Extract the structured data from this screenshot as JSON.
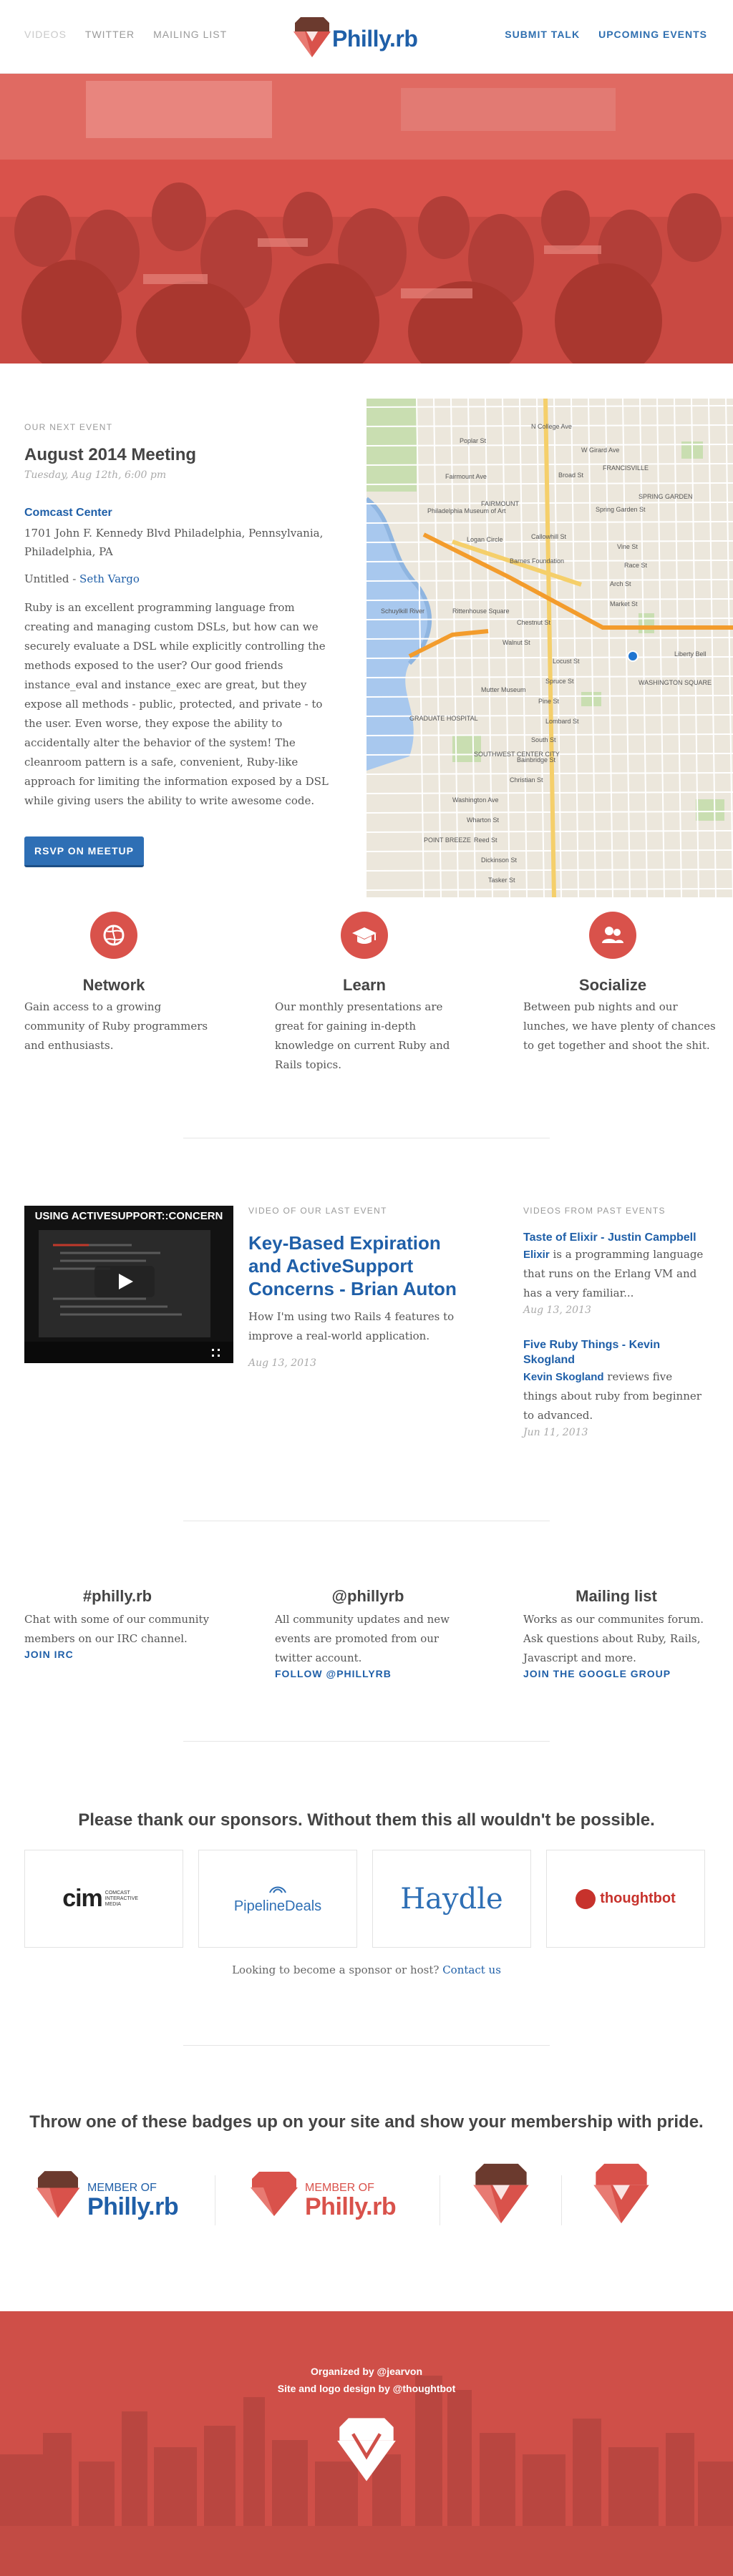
{
  "nav": {
    "left": [
      "Videos",
      "Twitter",
      "Mailing List"
    ],
    "right": [
      "Submit Talk",
      "Upcoming Events"
    ],
    "logo_text": "Philly.rb"
  },
  "event": {
    "kicker": "Our Next Event",
    "title": "August 2014 Meeting",
    "date": "Tuesday, Aug 12th, 6:00 pm",
    "venue": "Comcast Center",
    "address": "1701 John F. Kennedy Blvd Philadelphia, Pennsylvania, Philadelphia, PA",
    "talk_prefix": "Untitled - ",
    "speaker": "Seth Vargo",
    "description": "Ruby is an excellent programming language from creating and managing custom DSLs, but how can we securely evaluate a DSL while explicitly controlling the methods exposed to the user? Our good friends instance_eval and instance_exec are great, but they expose all methods - public, protected, and private - to the user. Even worse, they expose the ability to accidentally alter the behavior of the system! The cleanroom pattern is a safe, convenient, Ruby-like approach for limiting the information exposed by a DSL while giving users the ability to write awesome code.",
    "rsvp": "RSVP on Meetup"
  },
  "map": {
    "labels": [
      "N College Ave",
      "Poplar St",
      "W Girard Ave",
      "Fairmount Ave",
      "Spring Garden St",
      "Callowhill St",
      "Vine St",
      "Race St",
      "Arch St",
      "Market St",
      "Chestnut St",
      "Walnut St",
      "Locust St",
      "Spruce St",
      "Pine St",
      "Lombard St",
      "South St",
      "Bainbridge St",
      "Christian St",
      "Washington Ave",
      "Wharton St",
      "Reed St",
      "Dickinson St",
      "Tasker St",
      "Broad St",
      "Rittenhouse Square",
      "Logan Circle",
      "Philadelphia Museum of Art",
      "Barnes Foundation",
      "Liberty Bell",
      "Mutter Museum",
      "Schuylkill River",
      "FRANCISVILLE",
      "SPRING GARDEN",
      "FAIRMOUNT",
      "SOUTHWEST CENTER CITY",
      "GRADUATE HOSPITAL",
      "POINT BREEZE",
      "WASHINGTON SQUARE"
    ]
  },
  "features": [
    {
      "title": "Network",
      "text": "Gain access to a growing community of Ruby programmers and enthusiasts.",
      "icon": "network-icon"
    },
    {
      "title": "Learn",
      "text": "Our monthly presentations are great for gaining in-depth knowledge on current Ruby and Rails topics.",
      "icon": "graduation-cap-icon"
    },
    {
      "title": "Socialize",
      "text": "Between pub nights and our lunches, we have plenty of chances to get together and shoot the shit.",
      "icon": "people-icon"
    }
  ],
  "last_video": {
    "kicker": "Video of our last event",
    "thumb_title": "USING ACTIVESUPPORT::CONCERN",
    "title": "Key-Based Expiration and ActiveSupport Concerns - Brian Auton",
    "description": "How I'm using two Rails 4 features to improve a real-world application.",
    "date": "Aug 13, 2013"
  },
  "past_videos": {
    "kicker": "Videos from past events",
    "items": [
      {
        "title": "Taste of Elixir - Justin Campbell",
        "lead": "Elixir",
        "text": " is a programming language that runs on the Erlang VM and has a very familiar...",
        "date": "Aug 13, 2013"
      },
      {
        "title": "Five Ruby Things - Kevin Skogland",
        "lead": "Kevin Skogland",
        "text": " reviews five things about ruby from beginner to advanced.",
        "date": "Jun 11, 2013"
      }
    ]
  },
  "social": [
    {
      "title": "#philly.rb",
      "text": "Chat with some of our community members on our IRC channel.",
      "link": "Join IRC"
    },
    {
      "title": "@phillyrb",
      "text": "All community updates and new events are promoted from our twitter account.",
      "link": "Follow @phillyrb"
    },
    {
      "title": "Mailing list",
      "text": "Works as our communites forum. Ask questions about Ruby, Rails, Javascript and more.",
      "link": "Join the Google Group"
    }
  ],
  "sponsors": {
    "heading": "Please thank our sponsors. Without them this all wouldn't be possible.",
    "logos": [
      "cim",
      "COMCAST INTERACTIVE MEDIA",
      "PipelineDeals",
      "Haydle",
      "thoughtbot"
    ],
    "note_prefix": "Looking to become a sponsor or host? ",
    "note_link": "Contact us"
  },
  "badges": {
    "heading": "Throw one of these badges up on your site and show your membership with pride.",
    "member_of": "MEMBER OF",
    "name": "Philly.rb"
  },
  "footer": {
    "organized": "Organized by @jearvon",
    "design": "Site and logo design by @thoughtbot"
  },
  "colors": {
    "brand_red": "#d9524b",
    "brand_blue": "#1f5fa8",
    "brown": "#6b3a2e"
  }
}
